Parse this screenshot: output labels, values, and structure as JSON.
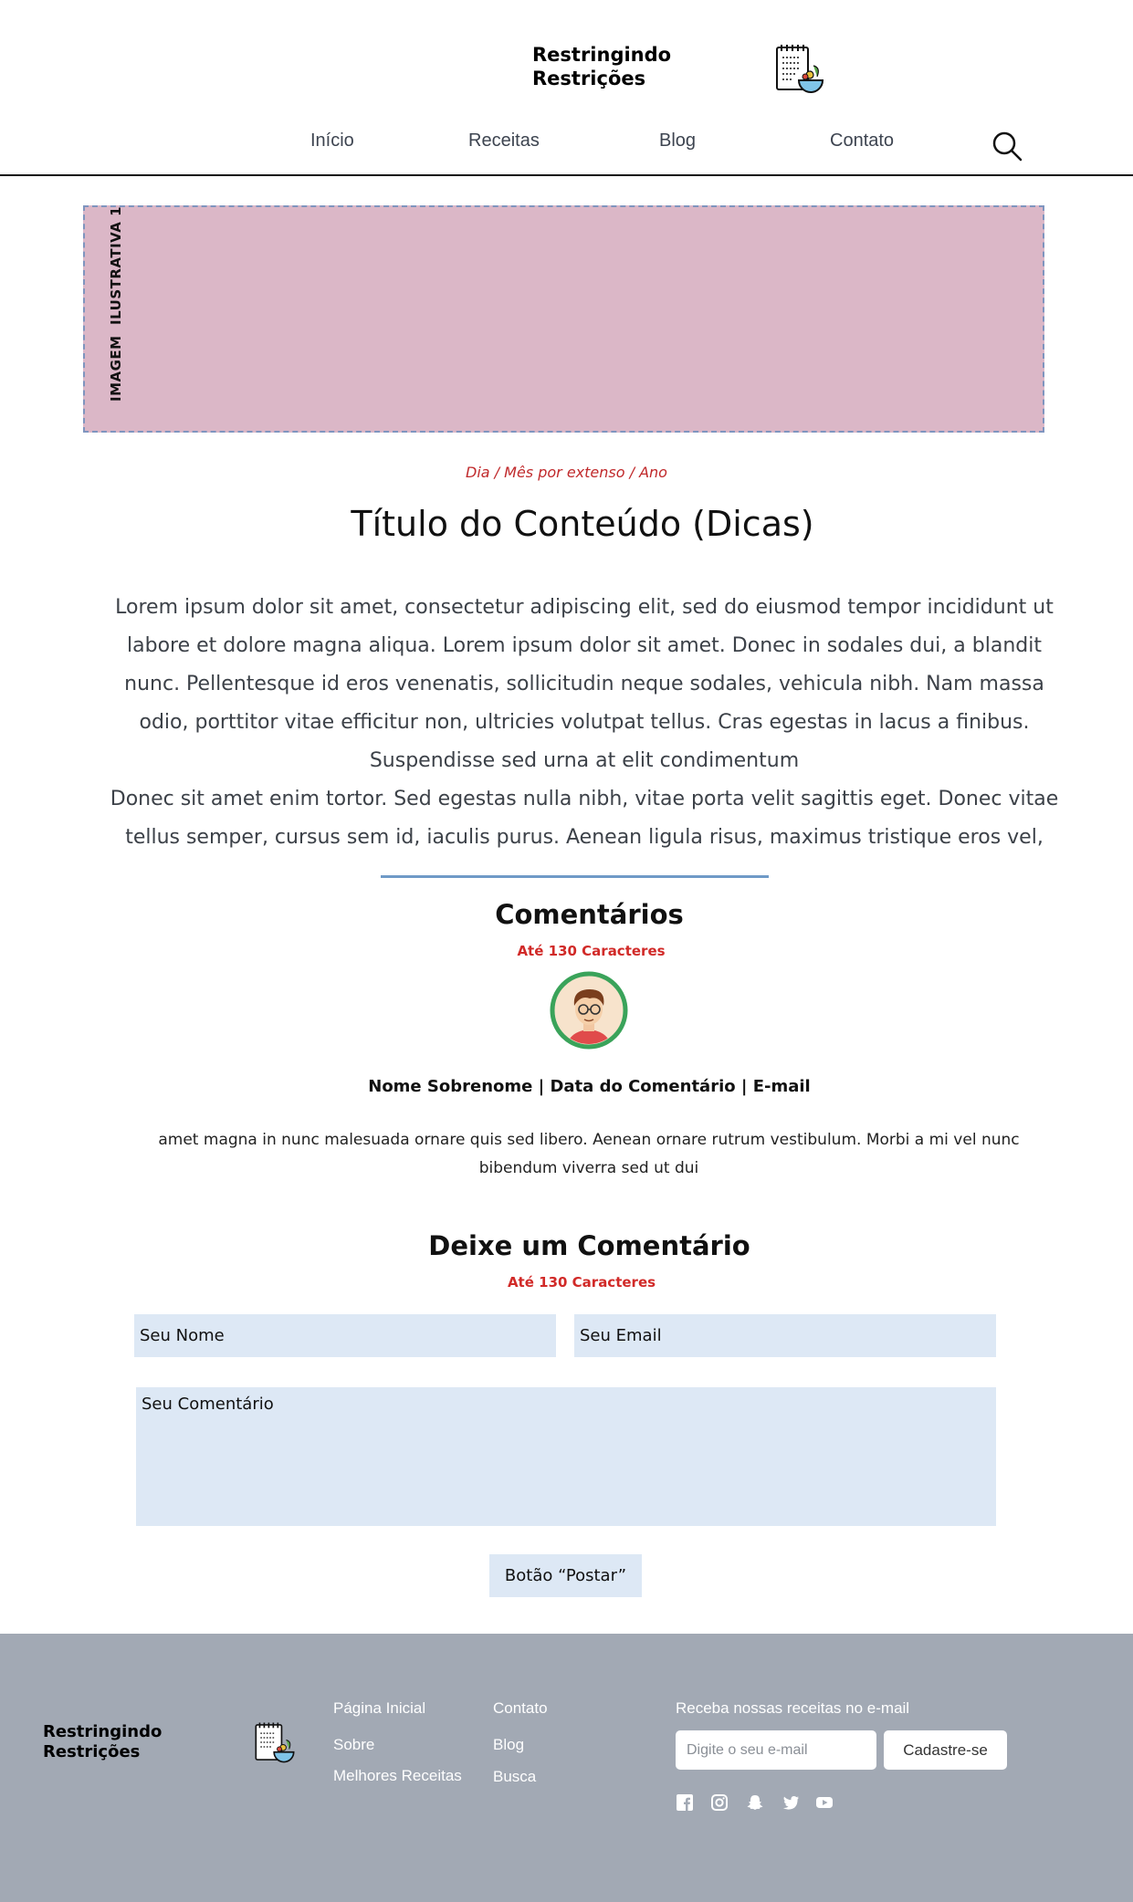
{
  "header": {
    "brand_line1": "Restringindo",
    "brand_line2": "Restrições",
    "nav": [
      "Início",
      "Receitas",
      "Blog",
      "Contato"
    ],
    "search_icon": "search-icon"
  },
  "hero": {
    "label": "IMAGEM  ILUSTRATIVA 1",
    "background": "#dbb7c7",
    "border": "#7f95bf"
  },
  "article": {
    "date": "Dia / Mês por extenso / Ano",
    "title": "Título do Conteúdo (Dicas)",
    "paragraph1": "Lorem ipsum dolor sit amet, consectetur adipiscing elit, sed do eiusmod tempor incididunt ut labore et dolore magna aliqua. Lorem ipsum dolor sit amet. Donec in sodales dui, a blandit nunc. Pellentesque id eros venenatis, sollicitudin neque sodales, vehicula nibh. Nam massa odio, porttitor vitae efficitur non, ultricies volutpat tellus. Cras egestas in lacus a finibus. Suspendisse sed urna at elit condimentum",
    "paragraph2": "Donec sit amet enim tortor. Sed egestas nulla nibh, vitae porta velit sagittis eget. Donec vitae tellus semper, cursus sem id, iaculis purus. Aenean ligula risus, maximus tristique eros vel, auctor ornare tor-"
  },
  "comments": {
    "title": "Comentários",
    "limit": "Até 130 Caracteres",
    "meta": "Nome Sobrenome | Data do Comentário | E-mail",
    "text": "amet magna in nunc malesuada ornare quis sed libero. Aenean ornare rutrum vestibulum. Morbi a mi vel nunc bibendum viverra sed ut dui"
  },
  "form": {
    "title": "Deixe um Comentário",
    "limit": "Até 130 Caracteres",
    "name_placeholder": "Seu Nome",
    "email_placeholder": "Seu Email",
    "comment_placeholder": "Seu Comentário",
    "post_label": "Botão “Postar”"
  },
  "footer": {
    "brand_line1": "Restringindo",
    "brand_line2": "Restrições",
    "col1": [
      "Página Inicial",
      "Sobre",
      "Melhores Receitas"
    ],
    "col2": [
      "Contato",
      "Blog",
      "Busca"
    ],
    "newsletter_label": "Receba nossas receitas no e-mail",
    "newsletter_placeholder": "Digite o seu e-mail",
    "subscribe_label": "Cadastre-se",
    "social_icons": [
      "facebook-icon",
      "instagram-icon",
      "snapchat-icon",
      "twitter-icon",
      "youtube-icon"
    ],
    "background": "#a2a9b4"
  },
  "colors": {
    "accent_red": "#c0292b",
    "input_bg": "#dde8f5",
    "divider_blue": "#6f9ac7"
  }
}
